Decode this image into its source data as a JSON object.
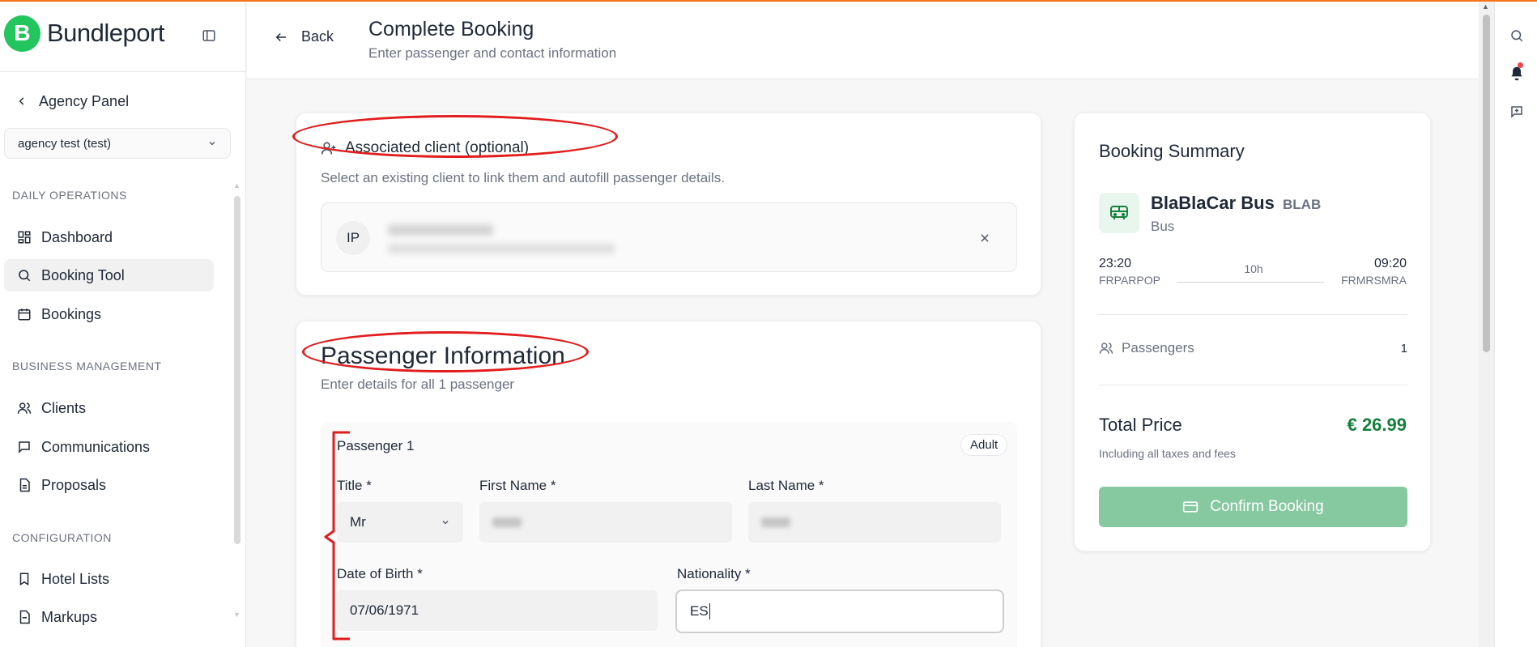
{
  "sidebar": {
    "brand": "Bundleport",
    "brand_initial": "B",
    "agency_back_label": "Agency Panel",
    "agency_selected": "agency test (test)",
    "sections": {
      "daily": "DAILY OPERATIONS",
      "business": "BUSINESS MANAGEMENT",
      "config": "CONFIGURATION"
    },
    "items": [
      {
        "label": "Dashboard",
        "icon": "dashboard-icon"
      },
      {
        "label": "Booking Tool",
        "icon": "search-icon",
        "active": true
      },
      {
        "label": "Bookings",
        "icon": "calendar-icon"
      },
      {
        "label": "Clients",
        "icon": "users-icon"
      },
      {
        "label": "Communications",
        "icon": "message-icon"
      },
      {
        "label": "Proposals",
        "icon": "document-icon"
      },
      {
        "label": "Hotel Lists",
        "icon": "bookmark-icon"
      },
      {
        "label": "Markups",
        "icon": "document-icon"
      }
    ]
  },
  "header": {
    "back_label": "Back",
    "title": "Complete Booking",
    "subtitle": "Enter passenger and contact information"
  },
  "client_card": {
    "title": "Associated client (optional)",
    "description": "Select an existing client to link them and autofill passenger details.",
    "selected_initials": "IP"
  },
  "passenger_card": {
    "title": "Passenger Information",
    "subtitle": "Enter details for all 1 passenger",
    "passenger_label": "Passenger 1",
    "type_badge": "Adult",
    "fields": {
      "title_label": "Title *",
      "title_value": "Mr",
      "first_name_label": "First Name *",
      "last_name_label": "Last Name *",
      "dob_label": "Date of Birth *",
      "dob_value": "07/06/1971",
      "nationality_label": "Nationality *",
      "nationality_value": "ES"
    }
  },
  "summary": {
    "title": "Booking Summary",
    "operator": "BlaBlaCar Bus",
    "operator_code": "BLAB",
    "transport_type": "Bus",
    "departure_time": "23:20",
    "departure_code": "FRPARPOP",
    "duration": "10h",
    "arrival_time": "09:20",
    "arrival_code": "FRMRSMRA",
    "passengers_label": "Passengers",
    "passengers_count": "1",
    "total_label": "Total Price",
    "total_price": "€ 26.99",
    "tax_note": "Including all taxes and fees",
    "confirm_label": "Confirm Booking"
  },
  "colors": {
    "brand_green": "#22c55e",
    "price_green": "#15803d",
    "confirm_disabled": "#86c8a0",
    "annotation_red": "#e11d1d",
    "top_accent": "#f97316"
  }
}
